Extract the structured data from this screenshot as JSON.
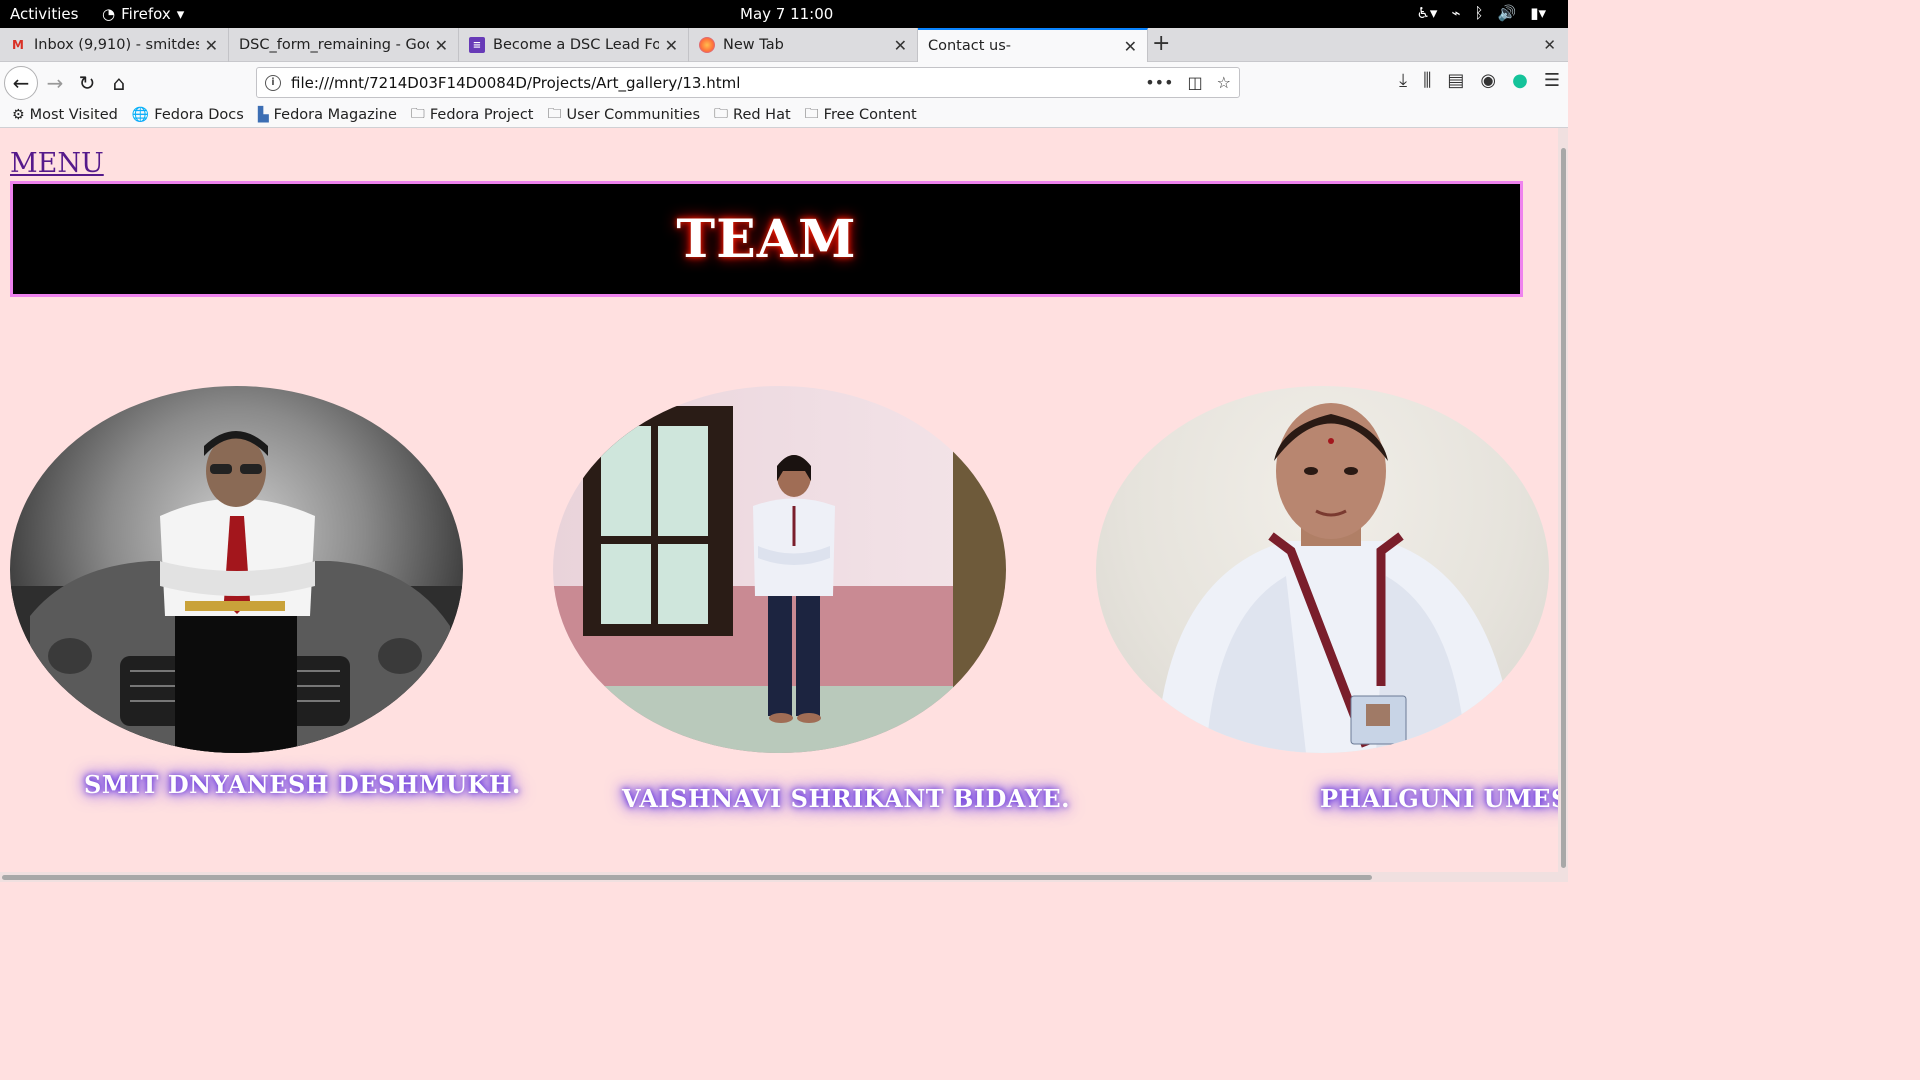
{
  "system": {
    "activities": "Activities",
    "app_name": "Firefox",
    "clock": "May 7  11:00"
  },
  "tabs": [
    {
      "label": "Inbox (9,910) - smitdeshm",
      "favicon": "gmail-icon"
    },
    {
      "label": "DSC_form_remaining - Goog",
      "favicon": "none"
    },
    {
      "label": "Become a DSC Lead Form",
      "favicon": "google-forms-icon"
    },
    {
      "label": "New Tab",
      "favicon": "firefox-icon"
    },
    {
      "label": "Contact us-",
      "favicon": "none",
      "active": true
    }
  ],
  "navigation": {
    "url": "file:///mnt/7214D03F14D0084D/Projects/Art_gallery/13.html"
  },
  "bookmarks": [
    {
      "label": "Most Visited",
      "icon": "gear-icon"
    },
    {
      "label": "Fedora Docs",
      "icon": "globe-icon"
    },
    {
      "label": "Fedora Magazine",
      "icon": "fedora-magazine-icon"
    },
    {
      "label": "Fedora Project",
      "icon": "folder-icon"
    },
    {
      "label": "User Communities",
      "icon": "folder-icon"
    },
    {
      "label": "Red Hat",
      "icon": "folder-icon"
    },
    {
      "label": "Free Content",
      "icon": "folder-icon"
    }
  ],
  "page": {
    "menu_link": "MENU",
    "title": "TEAM",
    "members": [
      {
        "name": "SMIT DNYANESH DESHMUKH."
      },
      {
        "name": "VAISHNAVI SHRIKANT BIDAYE."
      },
      {
        "name": "PHALGUNI UMES"
      }
    ]
  },
  "colors": {
    "page_background": "#ffe0e0",
    "banner_border": "#ee82ee",
    "link_visited": "#551a8b",
    "active_tab_accent": "#0a84ff"
  }
}
